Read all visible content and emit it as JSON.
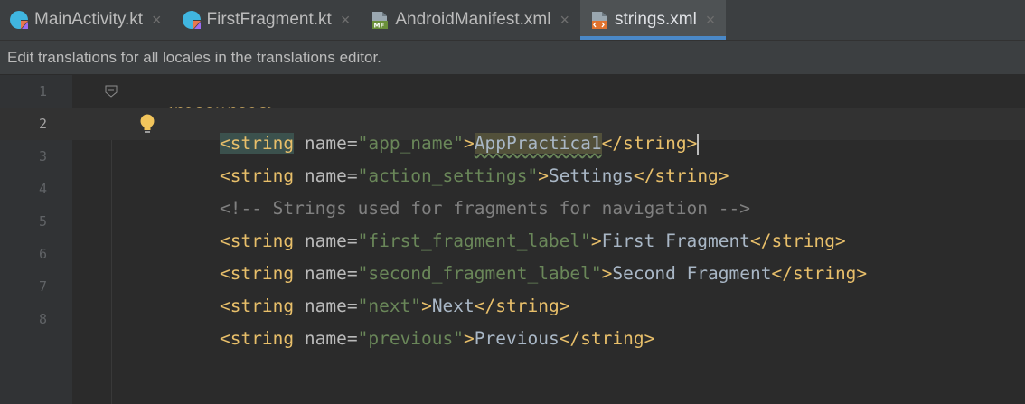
{
  "tabs": [
    {
      "label": "MainActivity.kt",
      "icon": "kotlin-file-icon",
      "active": false
    },
    {
      "label": "FirstFragment.kt",
      "icon": "kotlin-file-icon",
      "active": false
    },
    {
      "label": "AndroidManifest.xml",
      "icon": "manifest-file-icon",
      "active": false
    },
    {
      "label": "strings.xml",
      "icon": "xml-file-icon",
      "active": true
    }
  ],
  "close_glyph": "×",
  "banner": {
    "text": "Edit translations for all locales in the translations editor."
  },
  "editor": {
    "current_line": 2,
    "lines": [
      {
        "num": "1",
        "open": "<resources>"
      },
      {
        "num": "2",
        "open": "<string",
        "attr": " name=",
        "value": "\"app_name\"",
        "gt": ">",
        "text": "AppPractica1",
        "close": "</string>"
      },
      {
        "num": "3",
        "open": "<string",
        "attr": " name=",
        "value": "\"action_settings\"",
        "gt": ">",
        "text": "Settings",
        "close": "</string>"
      },
      {
        "num": "4",
        "comment": "<!-- Strings used for fragments for navigation -->"
      },
      {
        "num": "5",
        "open": "<string",
        "attr": " name=",
        "value": "\"first_fragment_label\"",
        "gt": ">",
        "text": "First Fragment",
        "close": "</string>"
      },
      {
        "num": "6",
        "open": "<string",
        "attr": " name=",
        "value": "\"second_fragment_label\"",
        "gt": ">",
        "text": "Second Fragment",
        "close": "</string>"
      },
      {
        "num": "7",
        "open": "<string",
        "attr": " name=",
        "value": "\"next\"",
        "gt": ">",
        "text": "Next",
        "close": "</string>"
      },
      {
        "num": "8",
        "open": "<string",
        "attr": " name=",
        "value": "\"previous\"",
        "gt": ">",
        "text": "Previous",
        "close": "</string>"
      }
    ]
  },
  "colors": {
    "background": "#2b2b2b",
    "tag": "#e8bf6a",
    "attribute_value": "#6a8759",
    "comment": "#808080",
    "tab_active_underline": "#4a88c7"
  }
}
